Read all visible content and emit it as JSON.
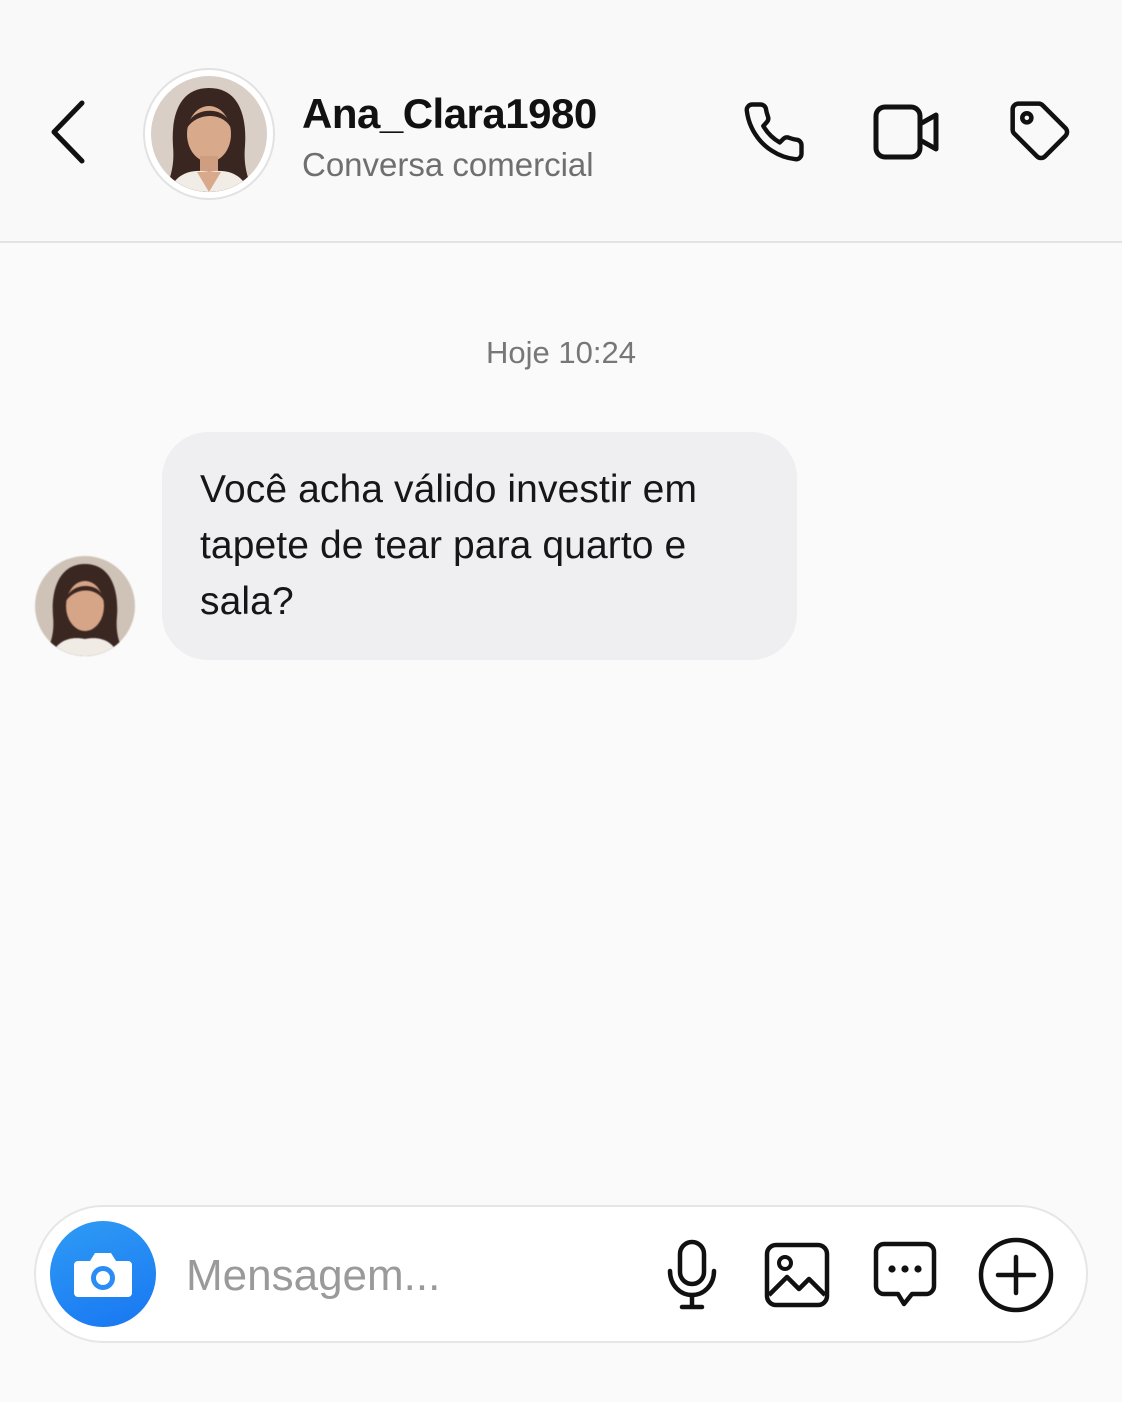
{
  "header": {
    "contact_name": "Ana_Clara1980",
    "contact_subtitle": "Conversa comercial",
    "icons": [
      "back-icon",
      "phone-icon",
      "video-icon",
      "tag-icon"
    ]
  },
  "chat": {
    "timestamp": "Hoje 10:24",
    "messages": [
      {
        "sender": "Ana_Clara1980",
        "text": "Você acha válido investir em tapete de tear para quarto e sala?"
      }
    ]
  },
  "composer": {
    "placeholder": "Mensagem...",
    "value": "",
    "icons": [
      "camera-icon",
      "microphone-icon",
      "image-icon",
      "chat-options-icon",
      "add-icon"
    ],
    "accent_color": "#1877f2"
  }
}
